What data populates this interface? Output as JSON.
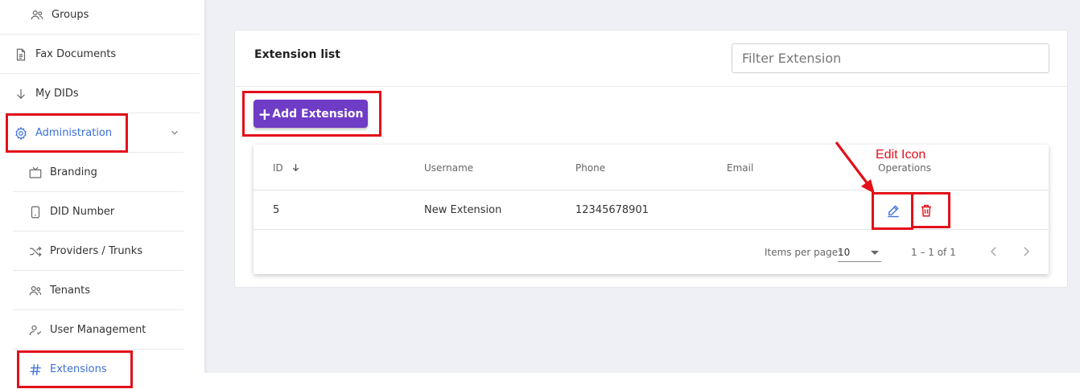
{
  "sidebar": {
    "items": [
      {
        "label": "Groups",
        "icon": "users-icon"
      },
      {
        "label": "Fax Documents",
        "icon": "document-icon"
      },
      {
        "label": "My DIDs",
        "icon": "arrow-down-icon"
      },
      {
        "label": "Administration",
        "icon": "gear-icon"
      },
      {
        "label": "Branding",
        "icon": "tv-icon"
      },
      {
        "label": "DID Number",
        "icon": "phone-device-icon"
      },
      {
        "label": "Providers / Trunks",
        "icon": "shuffle-icon"
      },
      {
        "label": "Tenants",
        "icon": "users-icon"
      },
      {
        "label": "User Management",
        "icon": "user-check-icon"
      },
      {
        "label": "Extensions",
        "icon": "hash-icon"
      }
    ]
  },
  "card": {
    "title": "Extension list",
    "filter_placeholder": "Filter Extension",
    "add_button_label": "Add Extension"
  },
  "table": {
    "columns": [
      "ID",
      "Username",
      "Phone",
      "Email",
      "Operations"
    ],
    "rows": [
      {
        "id": "5",
        "username": "New Extension",
        "phone": "12345678901",
        "email": ""
      }
    ],
    "footer": {
      "items_per_page_label": "Items per page:",
      "items_per_page_value": "10",
      "range": "1 – 1 of 1"
    }
  },
  "annotations": {
    "edit_label": "Edit Icon"
  },
  "colors": {
    "accent": "#3b6fd8",
    "button": "#6f3cc6",
    "edit_icon": "#3b6fd8",
    "delete_icon": "#e3101a",
    "highlight": "#e3101a"
  }
}
